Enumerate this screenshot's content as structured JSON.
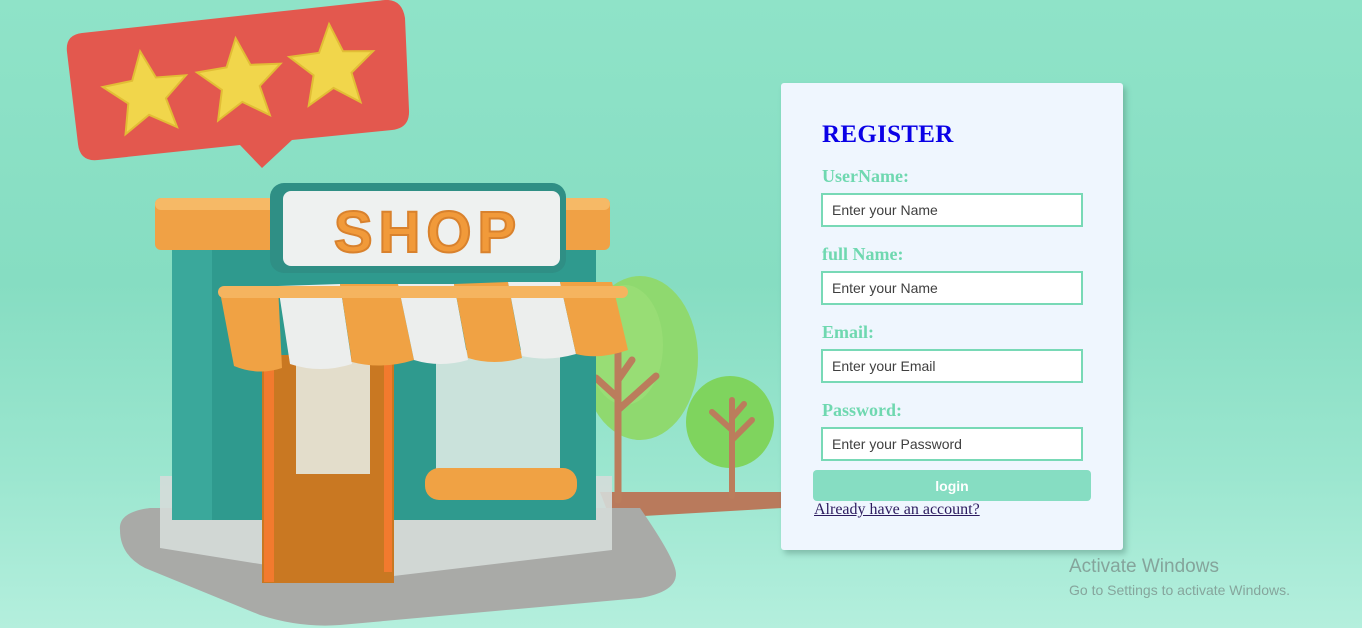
{
  "shop_sign": {
    "text": "SHOP"
  },
  "register": {
    "title": "REGISTER",
    "fields": [
      {
        "label": "UserName:",
        "placeholder": "Enter your Name"
      },
      {
        "label": "full Name:",
        "placeholder": "Enter your Name"
      },
      {
        "label": "Email:",
        "placeholder": "Enter your Email"
      },
      {
        "label": "Password:",
        "placeholder": "Enter your Password"
      }
    ],
    "login_label": "login",
    "account_link": "Already have an account?"
  },
  "rating": {
    "stars": 3
  },
  "watermark": {
    "title": "Activate Windows",
    "subtitle": "Go to Settings to activate Windows."
  },
  "colors": {
    "background": "#8fe3c8",
    "title": "#0a00e6",
    "label": "#6fd8b0",
    "button": "#86ddc2",
    "card": "#eff6fe"
  },
  "icons": [
    "rating-speech-bubble-icon",
    "star-icon",
    "shop-building-illustration",
    "tree-icon"
  ]
}
